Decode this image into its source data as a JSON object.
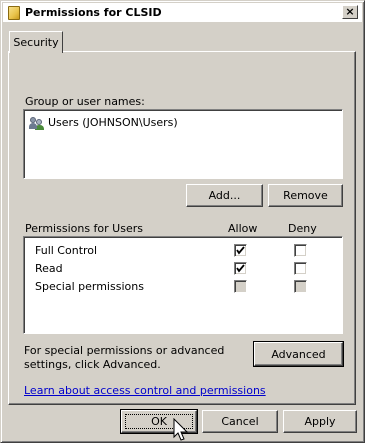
{
  "window": {
    "title": "Permissions for CLSID",
    "close_label": "×"
  },
  "tabs": [
    {
      "label": "Security",
      "selected": true
    }
  ],
  "group_section": {
    "label": "Group or user names:",
    "items": [
      {
        "name": "Users (JOHNSON\\Users)",
        "icon": "users-group-icon"
      }
    ],
    "add_label": "Add...",
    "remove_label": "Remove"
  },
  "permissions": {
    "label": "Permissions for Users",
    "allow_header": "Allow",
    "deny_header": "Deny",
    "rows": [
      {
        "name": "Full Control",
        "allow": true,
        "deny": false,
        "disabled": false
      },
      {
        "name": "Read",
        "allow": true,
        "deny": false,
        "disabled": false
      },
      {
        "name": "Special permissions",
        "allow": false,
        "deny": false,
        "disabled": true
      }
    ]
  },
  "advanced": {
    "text": "For special permissions or advanced settings, click Advanced.",
    "button_label": "Advanced"
  },
  "help_link": "Learn about access control and permissions",
  "footer": {
    "ok_label": "OK",
    "cancel_label": "Cancel",
    "apply_label": "Apply"
  },
  "colors": {
    "face": "#d4d0c8",
    "link": "#0000cc"
  }
}
